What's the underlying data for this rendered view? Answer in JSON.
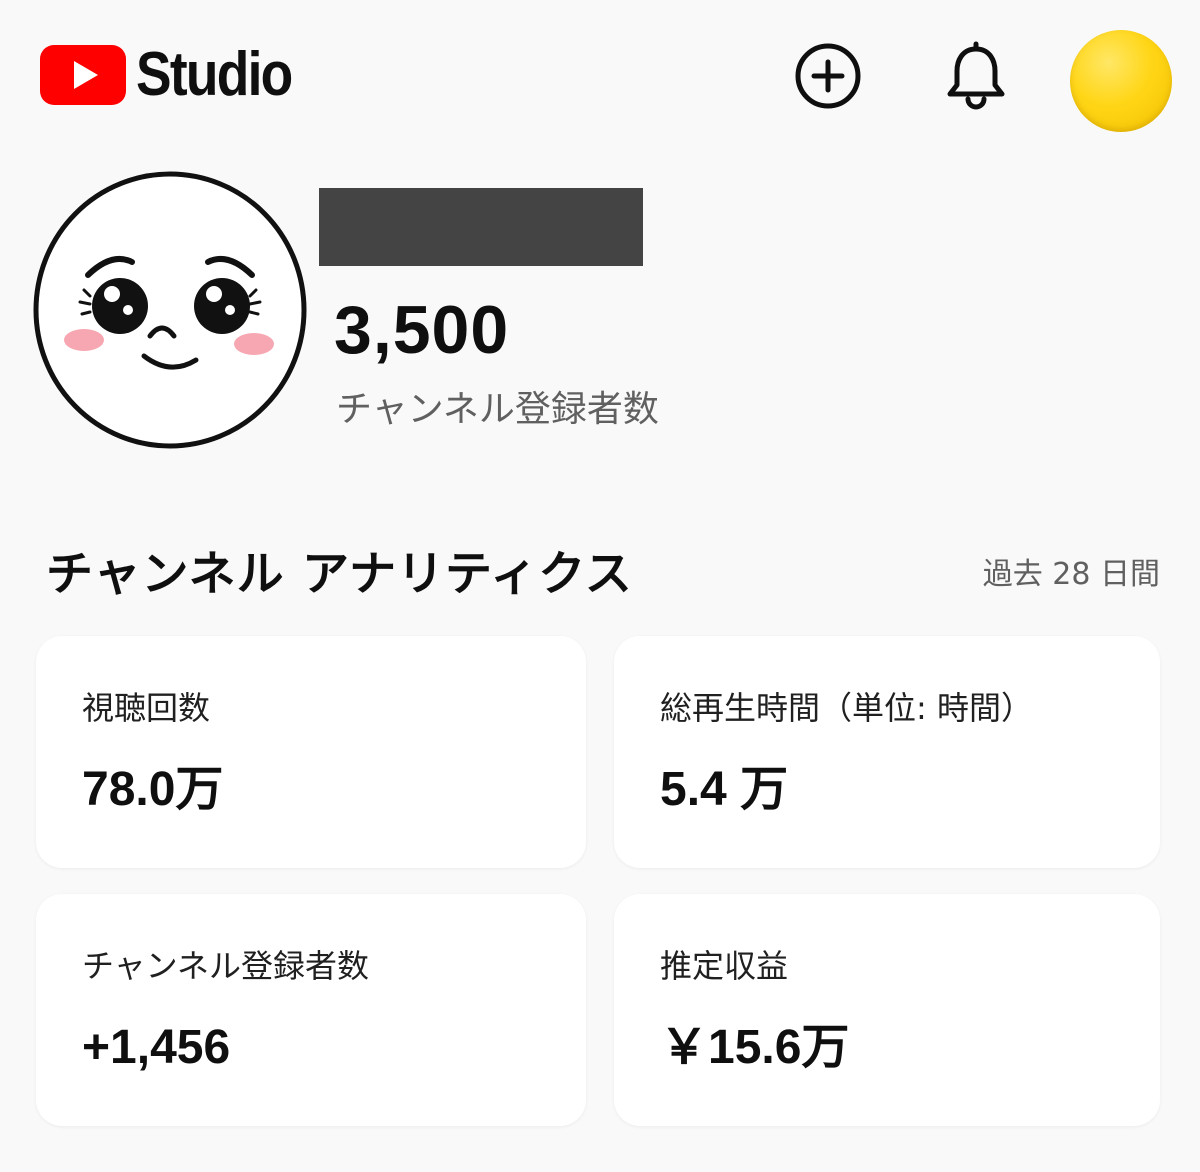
{
  "header": {
    "logo_text": "Studio",
    "icons": [
      "youtube-logo-icon",
      "plus-circle-icon",
      "bell-icon"
    ],
    "avatar_color": "#ffd617"
  },
  "channel": {
    "subscriber_count": "3,500",
    "subscriber_label": "チャンネル登録者数"
  },
  "analytics": {
    "title": "チャンネル アナリティクス",
    "period": "過去 28 日間",
    "cards": [
      {
        "label": "視聴回数",
        "value": "78.0万"
      },
      {
        "label": "総再生時間（単位: 時間）",
        "value": "5.4 万"
      },
      {
        "label": "チャンネル登録者数",
        "value": "+1,456"
      },
      {
        "label": "推定収益",
        "value": "￥15.6万"
      }
    ]
  },
  "colors": {
    "brand": "#ff0000",
    "background": "#f9f9f9",
    "card": "#ffffff",
    "muted_text": "#606060"
  }
}
